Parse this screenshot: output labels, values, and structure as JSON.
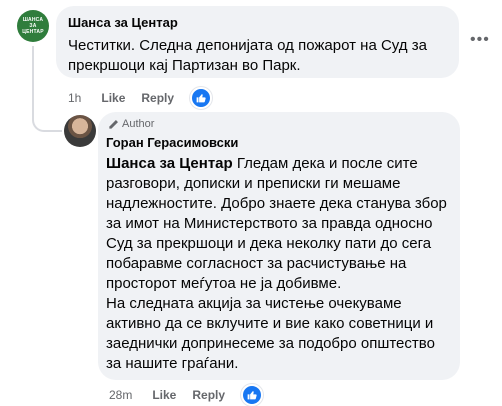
{
  "comments": [
    {
      "avatar_line1": "ШАНСА",
      "avatar_line2": "ЗА",
      "avatar_line3": "ЦЕНТАР",
      "author": "Шанса за Центар",
      "text": "Честитки. Следна депонијата од пожарот на Суд за прекршоци кај Партизан во Парк.",
      "time": "1h",
      "like_label": "Like",
      "reply_label": "Reply",
      "options_icon": "more-horizontal-icon",
      "reaction_icon": "thumbs-up-icon"
    },
    {
      "author_badge": "Author",
      "author": "Горан Герасимовски",
      "mention": "Шанса за Центар",
      "text": "Гледам дека и после сите разговори, дописки и преписки ги мешаме надлежностите. Добро знаете дека станува збор за имот на Министерството за правда односно Суд за прекршоци и дека неколку пати до сега побаравме согласност за расчистување на просторот меѓутоа не ја добивме.",
      "text2": "На следната акција за чистење очекуваме активно да се вклучите и вие како советници и заеднички допринесеме за подобро општество за нашите граѓани.",
      "time": "28m",
      "like_label": "Like",
      "reply_label": "Reply",
      "reaction_icon": "thumbs-up-icon"
    }
  ],
  "colors": {
    "bubble": "#f0f2f5",
    "meta_text": "#65676b",
    "reaction_blue": "#1877f2",
    "avatar_green": "#2f7d3c"
  }
}
